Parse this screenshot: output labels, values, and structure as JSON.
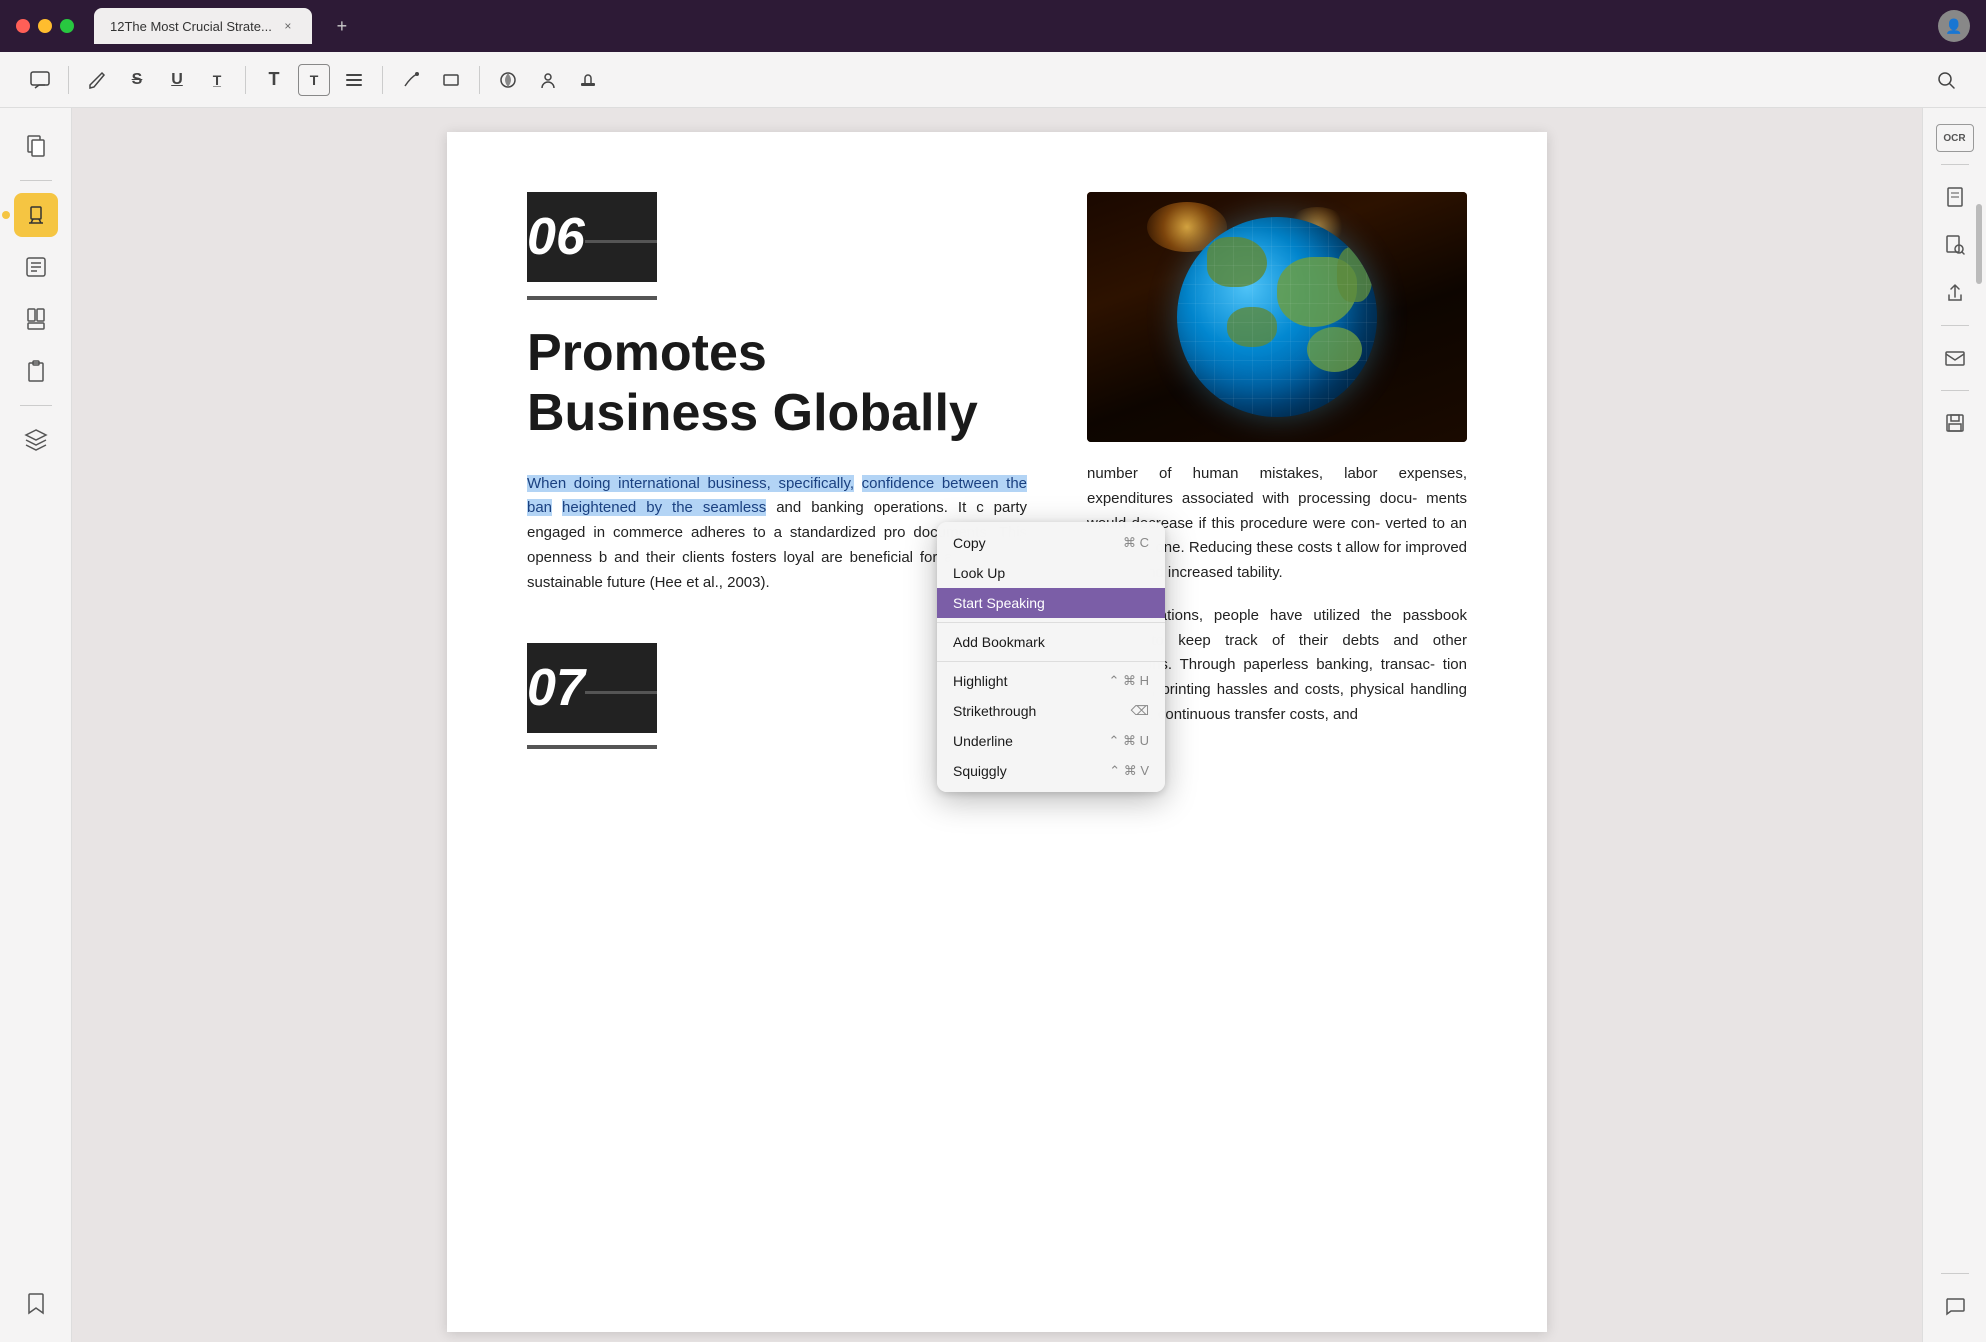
{
  "titlebar": {
    "tab_title": "12The Most Crucial Strate...",
    "add_tab_label": "+"
  },
  "toolbar": {
    "icons": [
      {
        "name": "comment-icon",
        "symbol": "💬"
      },
      {
        "name": "pencil-icon",
        "symbol": "✏"
      },
      {
        "name": "strikethrough-icon",
        "symbol": "S"
      },
      {
        "name": "underline-icon",
        "symbol": "U"
      },
      {
        "name": "underline-alt-icon",
        "symbol": "T̲"
      },
      {
        "name": "text-icon",
        "symbol": "T"
      },
      {
        "name": "text-box-icon",
        "symbol": "T"
      },
      {
        "name": "list-icon",
        "symbol": "≡"
      },
      {
        "name": "pen-icon",
        "symbol": "A"
      },
      {
        "name": "rectangle-icon",
        "symbol": "▭"
      },
      {
        "name": "color-icon",
        "symbol": "◉"
      },
      {
        "name": "user-icon",
        "symbol": "👤"
      },
      {
        "name": "stamp-icon",
        "symbol": "🖊"
      },
      {
        "name": "search-icon",
        "symbol": "🔍"
      }
    ]
  },
  "sidebar": {
    "items": [
      {
        "name": "pages-icon",
        "symbol": "📄",
        "active": false
      },
      {
        "name": "highlight-icon",
        "symbol": "🖊",
        "active": true
      },
      {
        "name": "notes-icon",
        "symbol": "📝",
        "active": false
      },
      {
        "name": "bookmarks-icon",
        "symbol": "📚",
        "active": false
      },
      {
        "name": "clipboard-icon",
        "symbol": "📋",
        "active": false
      },
      {
        "name": "layers-icon",
        "symbol": "⊞",
        "active": false
      },
      {
        "name": "bookmark-icon",
        "symbol": "🔖",
        "active": false
      }
    ]
  },
  "document": {
    "section_number": "06",
    "section_title_line1": "Promotes",
    "section_title_line2": "Business Globally",
    "body_text_plain": "and banking operations. It c party engaged in commerce adheres to a standardized pro documents. This openness b and their clients fosters loyal are beneficial for a long-term, sustainable future (Hee et al., 2003).",
    "body_text_highlighted_1": "When doing international business, specifically,",
    "body_text_highlighted_2": "confidence between the ban",
    "body_text_highlighted_3": "heightened by the seamless",
    "right_col_text_1": "number of human mistakes, labor expenses, expenditures associated with processing docu- ments would decrease if this procedure were con- verted to an electronic one. Reducing these costs t allow for improved service and increased tability.",
    "right_col_text_2": "For generations, people have utilized the passbook method to keep track of their debts and other transactions. Through paperless banking, transac- tion expenses, printing hassles and costs, physical handling of papers, continuous transfer costs, and",
    "section_number_2": "07"
  },
  "context_menu": {
    "items": [
      {
        "label": "Copy",
        "shortcut": "⌘ C",
        "active": false
      },
      {
        "label": "Look Up",
        "shortcut": "",
        "active": false
      },
      {
        "label": "Start Speaking",
        "shortcut": "",
        "active": true
      },
      {
        "label": "Add Bookmark",
        "shortcut": "",
        "active": false
      },
      {
        "label": "Highlight",
        "shortcut": "⌃ ⌘ H",
        "active": false
      },
      {
        "label": "Strikethrough",
        "shortcut": "⌫",
        "active": false
      },
      {
        "label": "Underline",
        "shortcut": "⌃ ⌘ U",
        "active": false
      },
      {
        "label": "Squiggly",
        "shortcut": "⌃ ⌘ V",
        "active": false
      }
    ]
  },
  "right_sidebar": {
    "icons": [
      {
        "name": "ocr-icon",
        "symbol": "OCR"
      },
      {
        "name": "page-icon",
        "symbol": "📄"
      },
      {
        "name": "search-doc-icon",
        "symbol": "🔍"
      },
      {
        "name": "share-icon",
        "symbol": "⬆"
      },
      {
        "name": "mail-icon",
        "symbol": "✉"
      },
      {
        "name": "save-icon",
        "symbol": "💾"
      },
      {
        "name": "chat-icon",
        "symbol": "💬"
      }
    ]
  }
}
